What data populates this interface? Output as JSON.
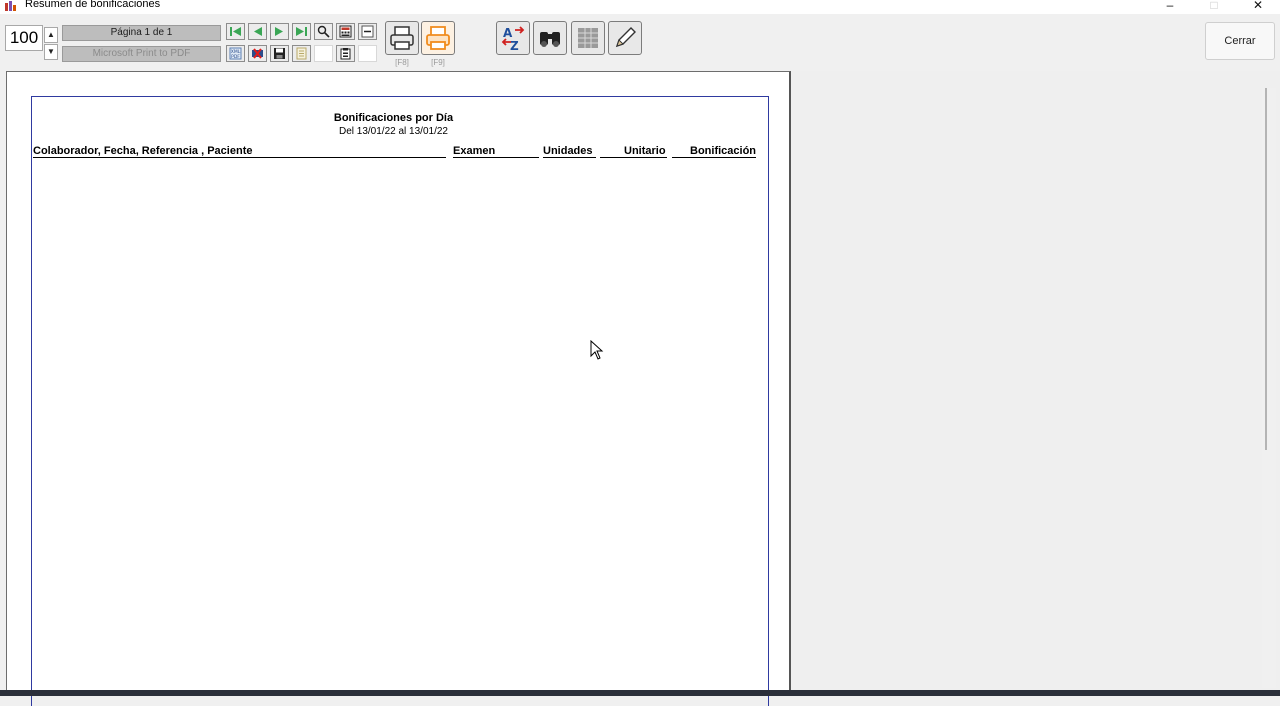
{
  "window": {
    "title": "Resumen de bonificaciones",
    "controls": {
      "minimize": "–",
      "maximize": "□",
      "close": "✕"
    }
  },
  "toolbar": {
    "zoom": "100",
    "page_indicator": "Página 1 de 1",
    "printer": "Microsoft Print to PDF",
    "print_hotkey": "[F8]",
    "print_all_hotkey": "[F9]",
    "close_label": "Cerrar",
    "icons": [
      "first-page-icon",
      "prev-page-icon",
      "next-page-icon",
      "last-page-icon",
      "zoom-tool-icon",
      "calculator-icon",
      "minus-icon",
      "export-icon",
      "excel-icon",
      "save-icon",
      "document-icon",
      "clipboard-icon",
      "printer-icon",
      "printer-all-icon",
      "sort-az-icon",
      "binoculars-icon",
      "grid-icon",
      "pencil-icon"
    ]
  },
  "report": {
    "title": "Bonificaciones por Día",
    "subtitle": "Del 13/01/22 al 13/01/22",
    "columns": [
      "Colaborador, Fecha, Referencia , Paciente",
      "Examen",
      "Unidades",
      "Unitario",
      "Bonificación"
    ]
  },
  "colors": {
    "page_border": "#2f3aa0",
    "accent_print": "#f08c1e",
    "nav_green": "#3aa655"
  }
}
